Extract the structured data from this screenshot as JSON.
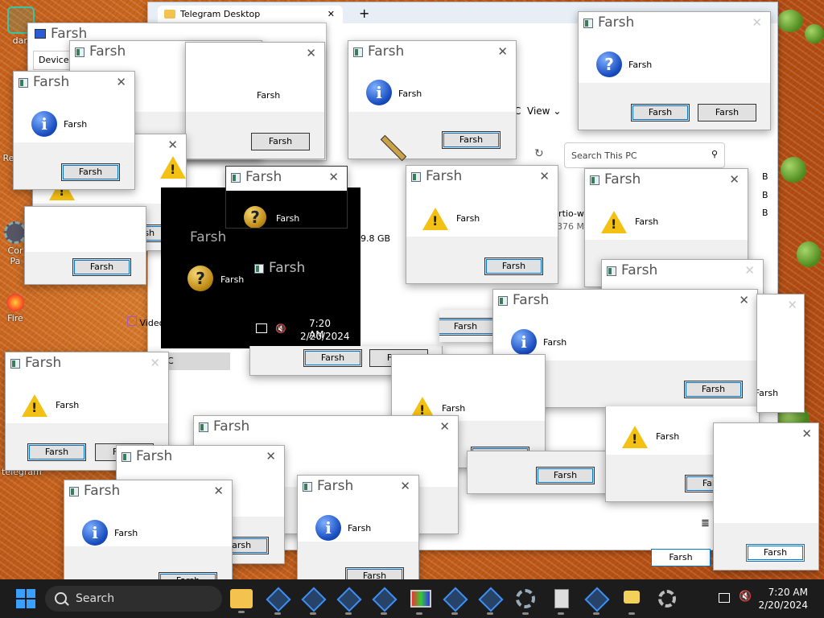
{
  "desktop": {
    "icons": [
      "dan",
      "Rec B",
      "Cor Pa",
      "Fire",
      "telegram"
    ]
  },
  "explorer": {
    "tab_title": "Telegram Desktop",
    "devices_label": "Devices",
    "view_label": "View",
    "search_placeholder": "Search This PC",
    "videos_label": "Videos",
    "virtio_label": "irtio-w",
    "virtio_size": "376 MB",
    "size_98": "9.8 GB",
    "this_pc_c": "C",
    "sizes_right": [
      "B",
      "B",
      "B"
    ]
  },
  "dialog": {
    "title": "Farsh",
    "message": "Farsh",
    "button": "Farsh",
    "close": "✕"
  },
  "black_overlay": {
    "time": "7:20 AM",
    "date": "2/20/2024"
  },
  "taskbar": {
    "search_label": "Search",
    "time": "7:20 AM",
    "date": "2/20/2024"
  },
  "colors": {
    "accent": "#0078d7",
    "taskbar": "#1c1c1c",
    "warning": "#f3c114",
    "info": "#1a4fc1"
  }
}
